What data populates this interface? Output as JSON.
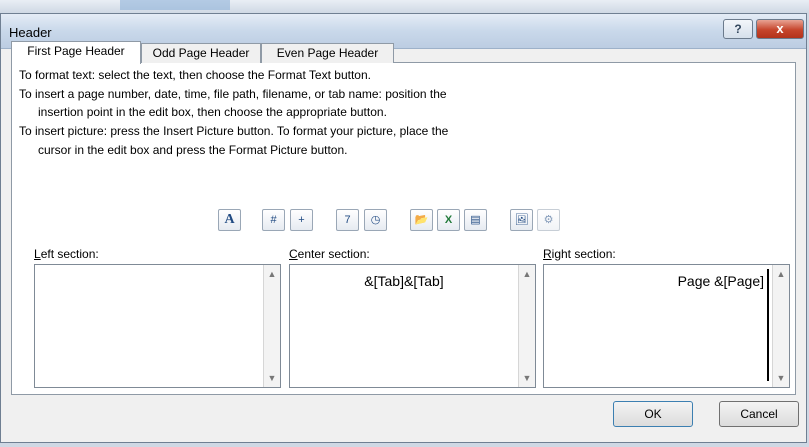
{
  "window": {
    "title": "Header",
    "help_label": "?",
    "close_label": "x"
  },
  "tabs": [
    {
      "label": "First Page Header",
      "active": true
    },
    {
      "label": "Odd Page Header",
      "active": false
    },
    {
      "label": "Even Page Header",
      "active": false
    }
  ],
  "instructions": [
    "To format text:  select the text, then choose the Format Text button.",
    "To insert a page number, date, time, file path, filename, or tab name:  position the",
    "insertion point in the edit box, then choose the appropriate button.",
    "To insert picture: press the Insert Picture button.  To format your picture, place the",
    "cursor in the edit box and press the Format Picture button."
  ],
  "toolbar": {
    "format_text": "A",
    "page_number": "#",
    "number_of_pages": "+",
    "date": "7",
    "time": "◷",
    "file_path": "📂",
    "file_name": "X",
    "sheet_name": "▤",
    "insert_picture": "🖼",
    "format_picture": "⚙"
  },
  "sections": {
    "left": {
      "label_u": "L",
      "label_rest": "eft section:",
      "value": ""
    },
    "center": {
      "label_u": "C",
      "label_rest": "enter section:",
      "value": "&[Tab]&[Tab]"
    },
    "right": {
      "label_u": "R",
      "label_rest": "ight section:",
      "value": "Page &[Page]"
    }
  },
  "buttons": {
    "ok": "OK",
    "cancel": "Cancel"
  }
}
